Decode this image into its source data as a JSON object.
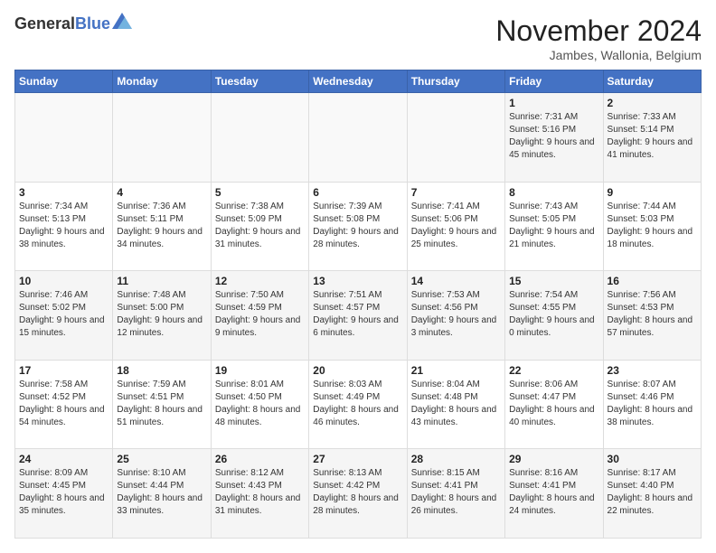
{
  "logo": {
    "line1": "General",
    "line2": "Blue"
  },
  "title": "November 2024",
  "location": "Jambes, Wallonia, Belgium",
  "days_header": [
    "Sunday",
    "Monday",
    "Tuesday",
    "Wednesday",
    "Thursday",
    "Friday",
    "Saturday"
  ],
  "weeks": [
    [
      {
        "day": "",
        "info": ""
      },
      {
        "day": "",
        "info": ""
      },
      {
        "day": "",
        "info": ""
      },
      {
        "day": "",
        "info": ""
      },
      {
        "day": "",
        "info": ""
      },
      {
        "day": "1",
        "info": "Sunrise: 7:31 AM\nSunset: 5:16 PM\nDaylight: 9 hours and 45 minutes."
      },
      {
        "day": "2",
        "info": "Sunrise: 7:33 AM\nSunset: 5:14 PM\nDaylight: 9 hours and 41 minutes."
      }
    ],
    [
      {
        "day": "3",
        "info": "Sunrise: 7:34 AM\nSunset: 5:13 PM\nDaylight: 9 hours and 38 minutes."
      },
      {
        "day": "4",
        "info": "Sunrise: 7:36 AM\nSunset: 5:11 PM\nDaylight: 9 hours and 34 minutes."
      },
      {
        "day": "5",
        "info": "Sunrise: 7:38 AM\nSunset: 5:09 PM\nDaylight: 9 hours and 31 minutes."
      },
      {
        "day": "6",
        "info": "Sunrise: 7:39 AM\nSunset: 5:08 PM\nDaylight: 9 hours and 28 minutes."
      },
      {
        "day": "7",
        "info": "Sunrise: 7:41 AM\nSunset: 5:06 PM\nDaylight: 9 hours and 25 minutes."
      },
      {
        "day": "8",
        "info": "Sunrise: 7:43 AM\nSunset: 5:05 PM\nDaylight: 9 hours and 21 minutes."
      },
      {
        "day": "9",
        "info": "Sunrise: 7:44 AM\nSunset: 5:03 PM\nDaylight: 9 hours and 18 minutes."
      }
    ],
    [
      {
        "day": "10",
        "info": "Sunrise: 7:46 AM\nSunset: 5:02 PM\nDaylight: 9 hours and 15 minutes."
      },
      {
        "day": "11",
        "info": "Sunrise: 7:48 AM\nSunset: 5:00 PM\nDaylight: 9 hours and 12 minutes."
      },
      {
        "day": "12",
        "info": "Sunrise: 7:50 AM\nSunset: 4:59 PM\nDaylight: 9 hours and 9 minutes."
      },
      {
        "day": "13",
        "info": "Sunrise: 7:51 AM\nSunset: 4:57 PM\nDaylight: 9 hours and 6 minutes."
      },
      {
        "day": "14",
        "info": "Sunrise: 7:53 AM\nSunset: 4:56 PM\nDaylight: 9 hours and 3 minutes."
      },
      {
        "day": "15",
        "info": "Sunrise: 7:54 AM\nSunset: 4:55 PM\nDaylight: 9 hours and 0 minutes."
      },
      {
        "day": "16",
        "info": "Sunrise: 7:56 AM\nSunset: 4:53 PM\nDaylight: 8 hours and 57 minutes."
      }
    ],
    [
      {
        "day": "17",
        "info": "Sunrise: 7:58 AM\nSunset: 4:52 PM\nDaylight: 8 hours and 54 minutes."
      },
      {
        "day": "18",
        "info": "Sunrise: 7:59 AM\nSunset: 4:51 PM\nDaylight: 8 hours and 51 minutes."
      },
      {
        "day": "19",
        "info": "Sunrise: 8:01 AM\nSunset: 4:50 PM\nDaylight: 8 hours and 48 minutes."
      },
      {
        "day": "20",
        "info": "Sunrise: 8:03 AM\nSunset: 4:49 PM\nDaylight: 8 hours and 46 minutes."
      },
      {
        "day": "21",
        "info": "Sunrise: 8:04 AM\nSunset: 4:48 PM\nDaylight: 8 hours and 43 minutes."
      },
      {
        "day": "22",
        "info": "Sunrise: 8:06 AM\nSunset: 4:47 PM\nDaylight: 8 hours and 40 minutes."
      },
      {
        "day": "23",
        "info": "Sunrise: 8:07 AM\nSunset: 4:46 PM\nDaylight: 8 hours and 38 minutes."
      }
    ],
    [
      {
        "day": "24",
        "info": "Sunrise: 8:09 AM\nSunset: 4:45 PM\nDaylight: 8 hours and 35 minutes."
      },
      {
        "day": "25",
        "info": "Sunrise: 8:10 AM\nSunset: 4:44 PM\nDaylight: 8 hours and 33 minutes."
      },
      {
        "day": "26",
        "info": "Sunrise: 8:12 AM\nSunset: 4:43 PM\nDaylight: 8 hours and 31 minutes."
      },
      {
        "day": "27",
        "info": "Sunrise: 8:13 AM\nSunset: 4:42 PM\nDaylight: 8 hours and 28 minutes."
      },
      {
        "day": "28",
        "info": "Sunrise: 8:15 AM\nSunset: 4:41 PM\nDaylight: 8 hours and 26 minutes."
      },
      {
        "day": "29",
        "info": "Sunrise: 8:16 AM\nSunset: 4:41 PM\nDaylight: 8 hours and 24 minutes."
      },
      {
        "day": "30",
        "info": "Sunrise: 8:17 AM\nSunset: 4:40 PM\nDaylight: 8 hours and 22 minutes."
      }
    ]
  ]
}
